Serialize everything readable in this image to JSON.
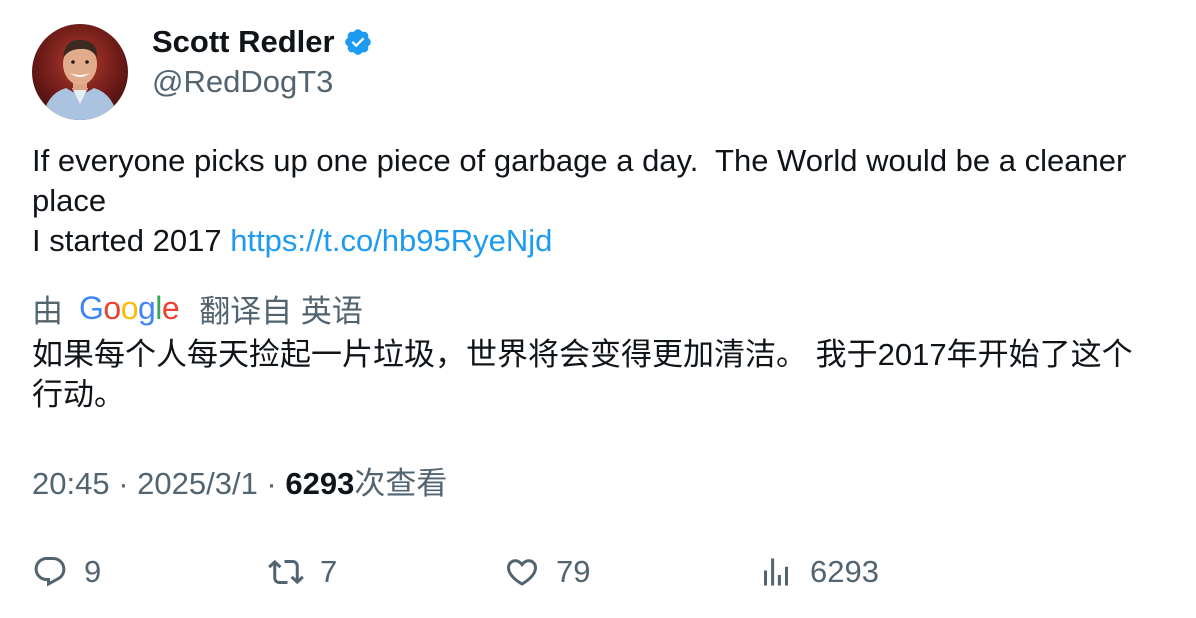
{
  "author": {
    "display_name": "Scott Redler",
    "handle": "@RedDogT3",
    "verified_icon": "verified-badge-icon",
    "avatar_icon": "profile-photo"
  },
  "tweet": {
    "text_line1": "If everyone picks up one piece of garbage a day.  The World would be a cleaner place",
    "text_line2_prefix": "I started 2017 ",
    "link": "https://t.co/hb95RyeNjd"
  },
  "translation": {
    "prefix": "由",
    "provider": "Google",
    "suffix": "翻译自 英语",
    "text": "如果每个人每天捡起一片垃圾，世界将会变得更加清洁。 我于2017年开始了这个行动。"
  },
  "meta": {
    "time": "20:45",
    "separator1": " · ",
    "date": "2025/3/1",
    "separator2": " · ",
    "views_count": "6293",
    "views_label": "次查看"
  },
  "actions": {
    "reply_count": "9",
    "retweet_count": "7",
    "like_count": "79",
    "views_count": "6293"
  },
  "colors": {
    "text": "#0f1419",
    "secondary": "#536471",
    "link": "#1d9bf0",
    "verified": "#1d9bf0"
  }
}
